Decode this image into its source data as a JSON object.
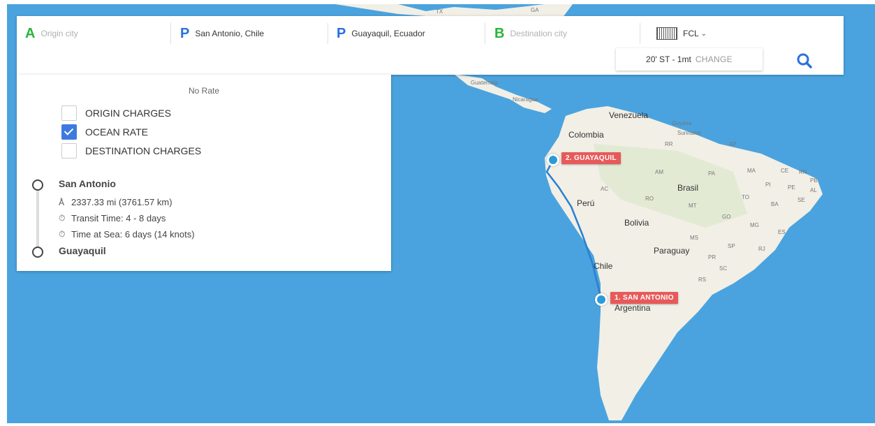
{
  "search": {
    "origin_letter": "A",
    "origin_placeholder": "Origin city",
    "port_from_letter": "P",
    "port_from": "San Antonio, Chile",
    "port_to_letter": "P",
    "port_to": "Guayaquil, Ecuador",
    "dest_letter": "B",
    "dest_placeholder": "Destination city",
    "load_type": "FCL",
    "container": "20' ST - 1mt",
    "change_label": "CHANGE"
  },
  "panel": {
    "rate_status": "No Rate",
    "charges": [
      {
        "label": "ORIGIN CHARGES",
        "checked": false
      },
      {
        "label": "OCEAN RATE",
        "checked": true
      },
      {
        "label": "DESTINATION CHARGES",
        "checked": false
      }
    ],
    "route": {
      "from": "San Antonio",
      "to": "Guayaquil",
      "distance": "2337.33 mi (3761.57 km)",
      "transit_time": "Transit Time: 4 - 8 days",
      "sea_time": "Time at Sea: 6 days (14 knots)"
    }
  },
  "map": {
    "markers": {
      "origin": "1. SAN ANTONIO",
      "destination": "2. GUAYAQUIL"
    },
    "labels": {
      "tx": "TX",
      "ga": "GA",
      "guatemala": "Guatemala",
      "nicaragua": "Nicaragua",
      "venezuela": "Venezuela",
      "guyana": "Guyana",
      "suriname": "Suriname",
      "colombia": "Colombia",
      "rr": "RR",
      "ap": "AP",
      "am": "AM",
      "pa": "PA",
      "ma": "MA",
      "ce": "CE",
      "rn": "RN",
      "pb": "PB",
      "pi": "PI",
      "pe": "PE",
      "al": "AL",
      "se": "SE",
      "ac": "AC",
      "ro": "RO",
      "brasil": "Brasil",
      "to": "TO",
      "ba": "BA",
      "peru": "Perú",
      "mt": "MT",
      "go": "GO",
      "mg": "MG",
      "es": "ES",
      "bolivia": "Bolivia",
      "ms": "MS",
      "sp": "SP",
      "rj": "RJ",
      "paraguay": "Paraguay",
      "pr": "PR",
      "sc": "SC",
      "rs": "RS",
      "chile": "Chile",
      "argentina": "Argentina"
    },
    "colors": {
      "ocean": "#4aa3de",
      "land": "#f1efe6",
      "route": "#2b7fd0",
      "marker": "#e75a5a"
    }
  }
}
